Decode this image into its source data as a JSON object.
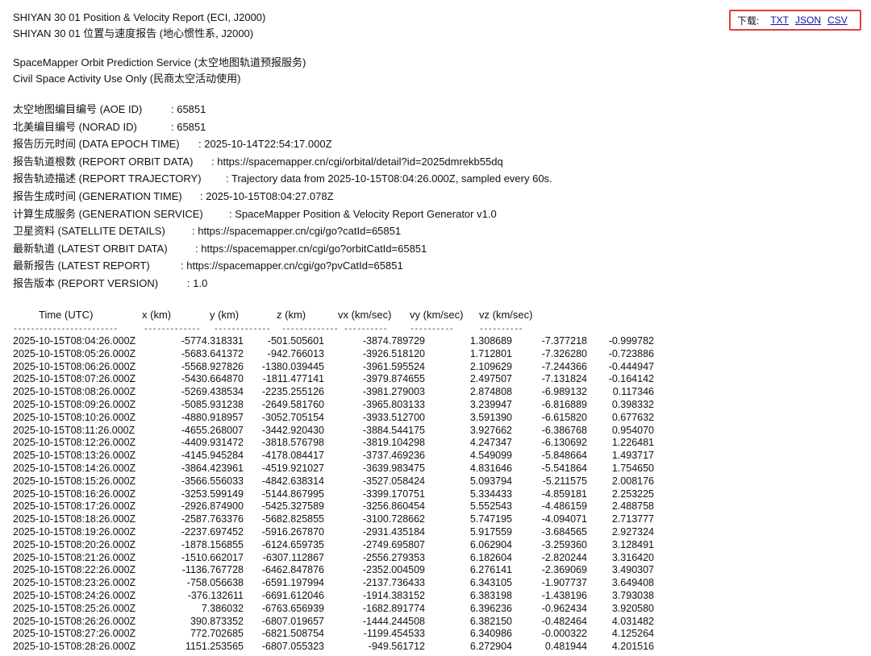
{
  "header": {
    "title_en": "SHIYAN 30 01 Position & Velocity Report (ECI, J2000)",
    "title_cn": "SHIYAN 30 01 位置与速度报告 (地心惯性系, J2000)"
  },
  "service": {
    "line1": "SpaceMapper Orbit Prediction Service (太空地图轨道预报服务)",
    "line2": "Civil Space Activity Use Only (民商太空活动使用)"
  },
  "download": {
    "label": "下载:",
    "links": [
      "TXT",
      "JSON",
      "CSV"
    ]
  },
  "meta": [
    {
      "key": "太空地图编目编号 (AOE ID)",
      "value": ": 65851"
    },
    {
      "key": "北美编目编号 (NORAD ID)",
      "value": ": 65851"
    },
    {
      "key": "报告历元时间 (DATA EPOCH TIME)",
      "value": ": 2025-10-14T22:54:17.000Z"
    },
    {
      "key": "报告轨道根数 (REPORT ORBIT DATA)",
      "value": ": https://spacemapper.cn/cgi/orbital/detail?id=2025dmrekb55dq"
    },
    {
      "key": "报告轨迹描述 (REPORT TRAJECTORY)",
      "value": ": Trajectory data from 2025-10-15T08:04:26.000Z, sampled every 60s."
    },
    {
      "key": "报告生成时间 (GENERATION TIME)",
      "value": ": 2025-10-15T08:04:27.078Z"
    },
    {
      "key": "计算生成服务 (GENERATION SERVICE)",
      "value": ": SpaceMapper Position & Velocity Report Generator v1.0"
    },
    {
      "key": "卫星资料 (SATELLITE DETAILS)",
      "value": ": https://spacemapper.cn/cgi/go?catId=65851"
    },
    {
      "key": "最新轨道 (LATEST ORBIT DATA)",
      "value": ": https://spacemapper.cn/cgi/go?orbitCatId=65851"
    },
    {
      "key": "最新报告 (LATEST REPORT)",
      "value": ": https://spacemapper.cn/cgi/go?pvCatId=65851"
    },
    {
      "key": "报告版本 (REPORT VERSION)",
      "value": ": 1.0"
    }
  ],
  "table": {
    "headers": [
      "Time (UTC)",
      "x (km)",
      "y (km)",
      "z (km)",
      "vx (km/sec)",
      "vy (km/sec)",
      "vz (km/sec)"
    ],
    "dashes": [
      "------------------------",
      "-------------",
      "-------------",
      "-------------",
      "----------",
      "----------",
      "----------"
    ],
    "rows": [
      [
        "2025-10-15T08:04:26.000Z",
        "-5774.318331",
        "-501.505601",
        "-3874.789729",
        "1.308689",
        "-7.377218",
        "-0.999782"
      ],
      [
        "2025-10-15T08:05:26.000Z",
        "-5683.641372",
        "-942.766013",
        "-3926.518120",
        "1.712801",
        "-7.326280",
        "-0.723886"
      ],
      [
        "2025-10-15T08:06:26.000Z",
        "-5568.927826",
        "-1380.039445",
        "-3961.595524",
        "2.109629",
        "-7.244366",
        "-0.444947"
      ],
      [
        "2025-10-15T08:07:26.000Z",
        "-5430.664870",
        "-1811.477141",
        "-3979.874655",
        "2.497507",
        "-7.131824",
        "-0.164142"
      ],
      [
        "2025-10-15T08:08:26.000Z",
        "-5269.438534",
        "-2235.255126",
        "-3981.279003",
        "2.874808",
        "-6.989132",
        "0.117346"
      ],
      [
        "2025-10-15T08:09:26.000Z",
        "-5085.931238",
        "-2649.581760",
        "-3965.803133",
        "3.239947",
        "-6.816889",
        "0.398332"
      ],
      [
        "2025-10-15T08:10:26.000Z",
        "-4880.918957",
        "-3052.705154",
        "-3933.512700",
        "3.591390",
        "-6.615820",
        "0.677632"
      ],
      [
        "2025-10-15T08:11:26.000Z",
        "-4655.268007",
        "-3442.920430",
        "-3884.544175",
        "3.927662",
        "-6.386768",
        "0.954070"
      ],
      [
        "2025-10-15T08:12:26.000Z",
        "-4409.931472",
        "-3818.576798",
        "-3819.104298",
        "4.247347",
        "-6.130692",
        "1.226481"
      ],
      [
        "2025-10-15T08:13:26.000Z",
        "-4145.945284",
        "-4178.084417",
        "-3737.469236",
        "4.549099",
        "-5.848664",
        "1.493717"
      ],
      [
        "2025-10-15T08:14:26.000Z",
        "-3864.423961",
        "-4519.921027",
        "-3639.983475",
        "4.831646",
        "-5.541864",
        "1.754650"
      ],
      [
        "2025-10-15T08:15:26.000Z",
        "-3566.556033",
        "-4842.638314",
        "-3527.058424",
        "5.093794",
        "-5.211575",
        "2.008176"
      ],
      [
        "2025-10-15T08:16:26.000Z",
        "-3253.599149",
        "-5144.867995",
        "-3399.170751",
        "5.334433",
        "-4.859181",
        "2.253225"
      ],
      [
        "2025-10-15T08:17:26.000Z",
        "-2926.874900",
        "-5425.327589",
        "-3256.860454",
        "5.552543",
        "-4.486159",
        "2.488758"
      ],
      [
        "2025-10-15T08:18:26.000Z",
        "-2587.763376",
        "-5682.825855",
        "-3100.728662",
        "5.747195",
        "-4.094071",
        "2.713777"
      ],
      [
        "2025-10-15T08:19:26.000Z",
        "-2237.697452",
        "-5916.267870",
        "-2931.435184",
        "5.917559",
        "-3.684565",
        "2.927324"
      ],
      [
        "2025-10-15T08:20:26.000Z",
        "-1878.156855",
        "-6124.659735",
        "-2749.695807",
        "6.062904",
        "-3.259360",
        "3.128491"
      ],
      [
        "2025-10-15T08:21:26.000Z",
        "-1510.662017",
        "-6307.112867",
        "-2556.279353",
        "6.182604",
        "-2.820244",
        "3.316420"
      ],
      [
        "2025-10-15T08:22:26.000Z",
        "-1136.767728",
        "-6462.847876",
        "-2352.004509",
        "6.276141",
        "-2.369069",
        "3.490307"
      ],
      [
        "2025-10-15T08:23:26.000Z",
        "-758.056638",
        "-6591.197994",
        "-2137.736433",
        "6.343105",
        "-1.907737",
        "3.649408"
      ],
      [
        "2025-10-15T08:24:26.000Z",
        "-376.132611",
        "-6691.612046",
        "-1914.383152",
        "6.383198",
        "-1.438196",
        "3.793038"
      ],
      [
        "2025-10-15T08:25:26.000Z",
        "7.386032",
        "-6763.656939",
        "-1682.891774",
        "6.396236",
        "-0.962434",
        "3.920580"
      ],
      [
        "2025-10-15T08:26:26.000Z",
        "390.873352",
        "-6807.019657",
        "-1444.244508",
        "6.382150",
        "-0.482464",
        "4.031482"
      ],
      [
        "2025-10-15T08:27:26.000Z",
        "772.702685",
        "-6821.508754",
        "-1199.454533",
        "6.340986",
        "-0.000322",
        "4.125264"
      ],
      [
        "2025-10-15T08:28:26.000Z",
        "1151.253565",
        "-6807.055323",
        "-949.561712",
        "6.272904",
        "0.481944",
        "4.201516"
      ]
    ]
  }
}
